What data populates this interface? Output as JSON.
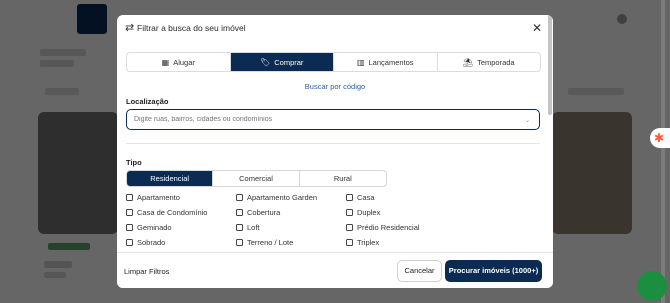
{
  "modal": {
    "title": "Filtrar a busca do seu imóvel",
    "header_icon": "swap-arrows-icon",
    "close_icon": "close-icon"
  },
  "tabs": [
    {
      "label": "Alugar",
      "icon": "calendar-icon",
      "active": false
    },
    {
      "label": "Comprar",
      "icon": "key-card-icon",
      "active": true
    },
    {
      "label": "Lançamentos",
      "icon": "building-icon",
      "active": false
    },
    {
      "label": "Temporada",
      "icon": "beach-umbrella-icon",
      "active": false
    }
  ],
  "code_link": "Buscar por código",
  "location": {
    "label": "Localização",
    "placeholder": "Digite ruas, bairros, cidades ou condomínios"
  },
  "tipo": {
    "label": "Tipo",
    "segments": [
      {
        "label": "Residencial",
        "active": true
      },
      {
        "label": "Comercial",
        "active": false
      },
      {
        "label": "Rural",
        "active": false
      }
    ],
    "options": [
      [
        "Apartamento",
        "Apartamento Garden",
        "Casa"
      ],
      [
        "Casa de Condomínio",
        "Cobertura",
        "Duplex"
      ],
      [
        "Geminado",
        "Loft",
        "Prédio Residencial"
      ],
      [
        "Sobrado",
        "Terreno / Lote",
        "Triplex"
      ]
    ]
  },
  "footer": {
    "clear_label": "Limpar Filtros",
    "cancel_label": "Cancelar",
    "search_label": "Procurar imóveis (1000+)"
  },
  "colors": {
    "primary": "#0c2b52",
    "link": "#2d5fa8",
    "overlay": "rgba(0,0,0,0.58)"
  }
}
